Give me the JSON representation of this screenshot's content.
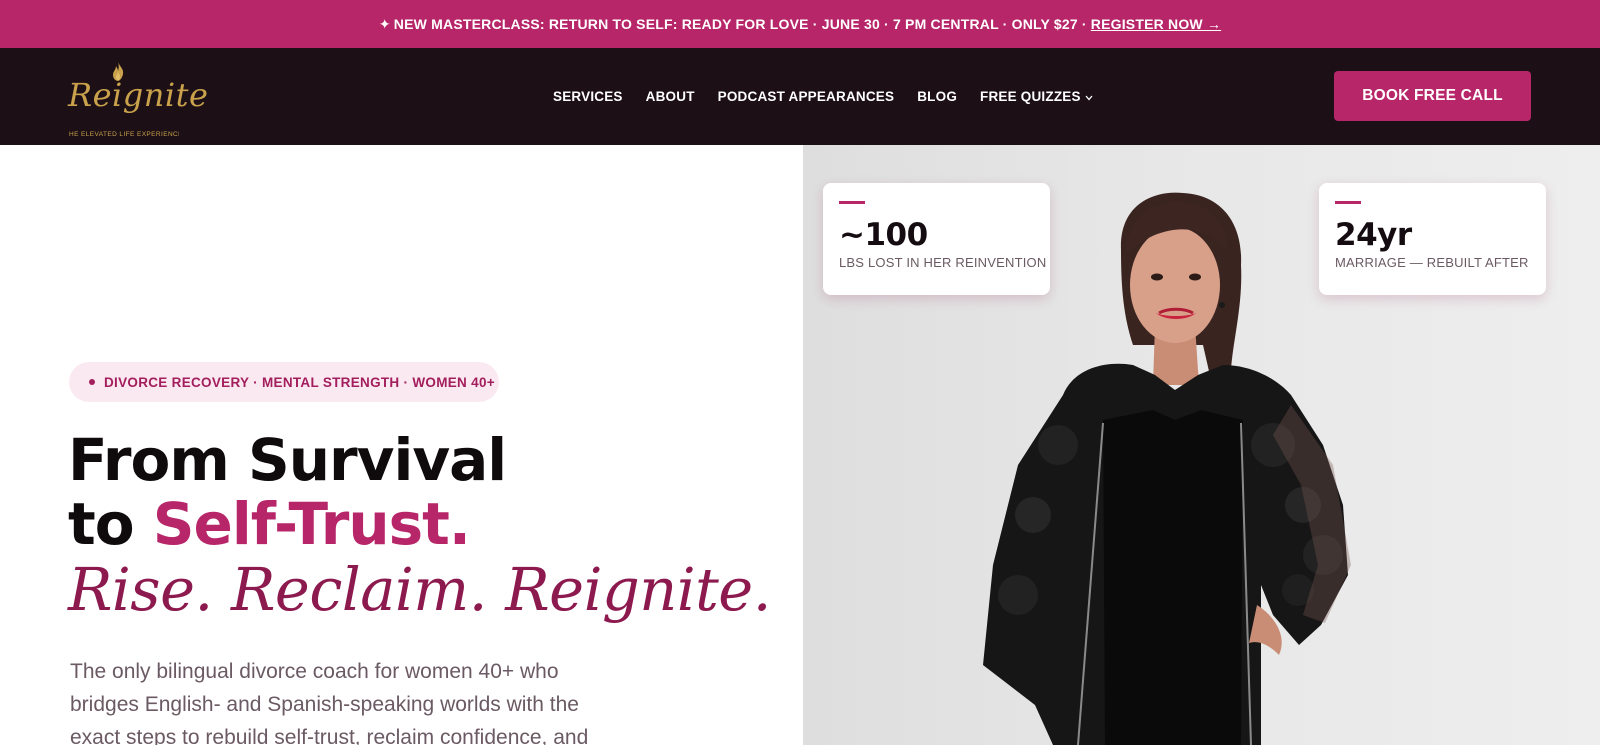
{
  "announcement": {
    "spark_icon": "✦",
    "text": "NEW MASTERCLASS: RETURN TO SELF: READY FOR LOVE · JUNE 30 · 7 PM CENTRAL · ONLY $27 ·",
    "link_label": "REGISTER NOW →"
  },
  "header": {
    "logo": {
      "wordmark": "Reignite",
      "tagline": "HE ELEVATED LIFE EXPERIENCE"
    },
    "nav": [
      {
        "label": "SERVICES"
      },
      {
        "label": "ABOUT"
      },
      {
        "label": "PODCAST APPEARANCES"
      },
      {
        "label": "BLOG"
      },
      {
        "label": "FREE QUIZZES",
        "has_dropdown": true
      }
    ],
    "cta_label": "BOOK FREE CALL"
  },
  "hero": {
    "pill": "DIVORCE RECOVERY · MENTAL STRENGTH · WOMEN 40+",
    "headline_line1": "From Survival",
    "headline_line2_prefix": "to",
    "headline_line2_accent": "Self-Trust.",
    "script_line": "Rise. Reclaim. Reignite.",
    "body": "The only bilingual divorce coach for women 40+ who bridges English- and Spanish-speaking worlds with the exact steps to rebuild self-trust, reclaim confidence, and"
  },
  "stats": [
    {
      "value": "~100",
      "label": "LBS LOST IN HER REINVENTION"
    },
    {
      "value": "24yr",
      "label": "MARRIAGE — REBUILT AFTER"
    }
  ],
  "colors": {
    "brand_magenta": "#b8266a",
    "header_dark": "#1c0f16",
    "logo_gold": "#c9a24b",
    "script_plum": "#8d1a4e"
  }
}
